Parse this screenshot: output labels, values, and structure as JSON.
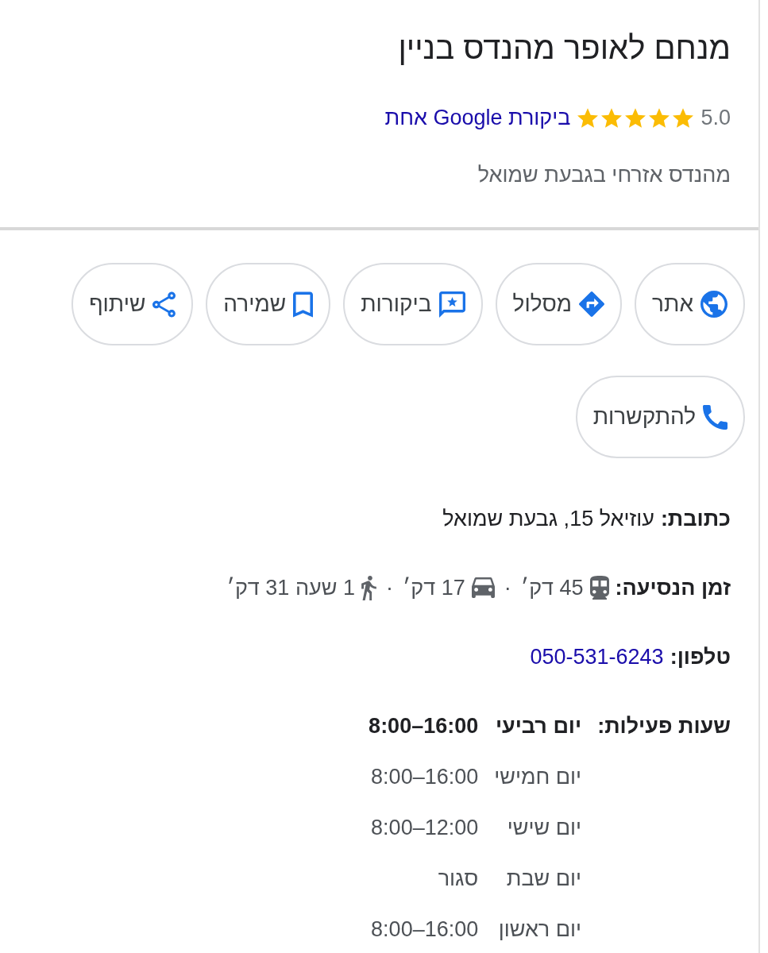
{
  "header": {
    "title": "מנחם לאופר מהנדס בניין",
    "rating": {
      "score": "5.0",
      "stars": 5,
      "reviews_link": "ביקורת Google אחת"
    },
    "category": "מהנדס אזרחי בגבעת שמואל"
  },
  "actions": [
    {
      "kind": "website",
      "label": "אתר"
    },
    {
      "kind": "directions",
      "label": "מסלול"
    },
    {
      "kind": "reviews",
      "label": "ביקורות"
    },
    {
      "kind": "save",
      "label": "שמירה"
    },
    {
      "kind": "share",
      "label": "שיתוף"
    },
    {
      "kind": "call",
      "label": "להתקשרות"
    }
  ],
  "details": {
    "address": {
      "label": "כתובת:",
      "value": "עוזיאל 15, גבעת שמואל"
    },
    "travel_time": {
      "label": "זמן הנסיעה:",
      "modes": [
        {
          "kind": "transit",
          "time": "45 דק׳",
          "separator": "·"
        },
        {
          "kind": "car",
          "time": "17 דק׳",
          "separator": "·"
        },
        {
          "kind": "walk",
          "time": "1 שעה 31 דק׳"
        }
      ]
    },
    "phone": {
      "label": "טלפון:",
      "value": "050-531-6243"
    },
    "hours": {
      "label": "שעות פעילות:",
      "days": [
        {
          "day": "יום רביעי",
          "hours": "8:00–16:00",
          "today": true
        },
        {
          "day": "יום חמישי",
          "hours": "8:00–16:00",
          "today": false
        },
        {
          "day": "יום שישי",
          "hours": "8:00–12:00",
          "today": false
        },
        {
          "day": "יום שבת",
          "hours": "סגור",
          "today": false
        },
        {
          "day": "יום ראשון",
          "hours": "8:00–16:00",
          "today": false
        }
      ]
    }
  }
}
